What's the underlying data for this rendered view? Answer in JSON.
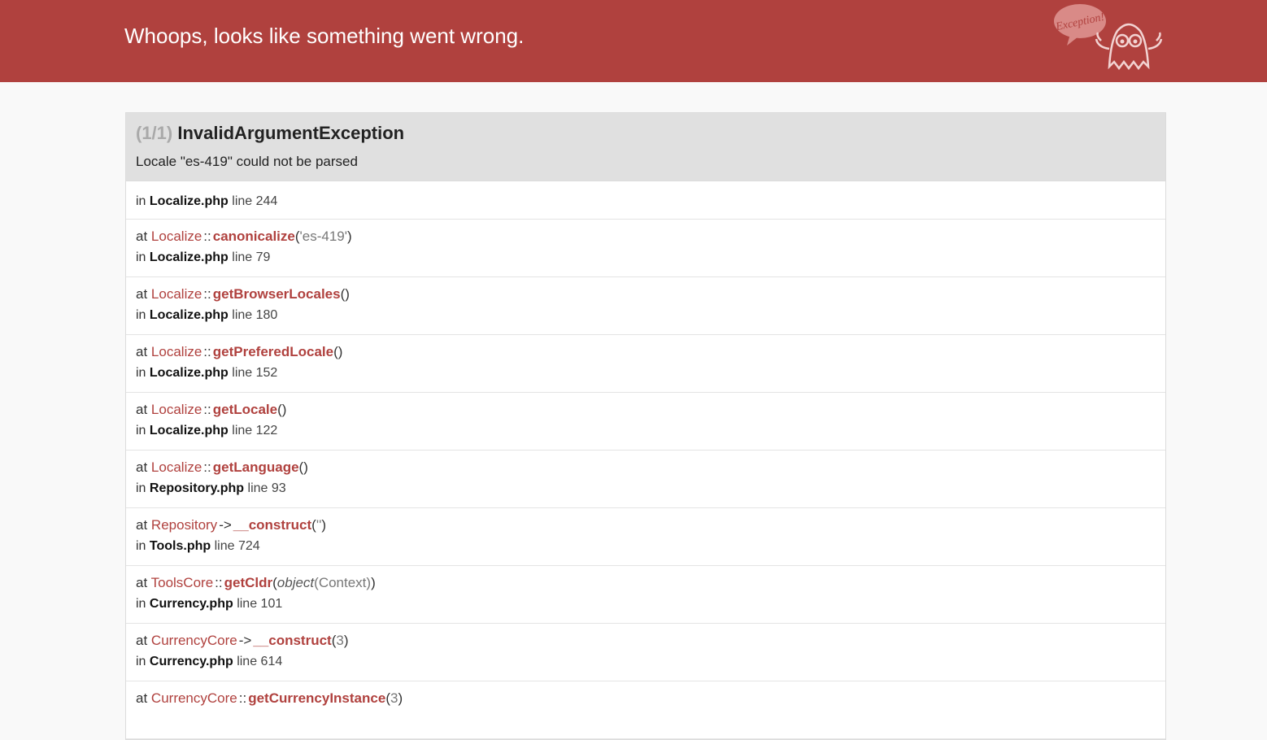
{
  "header": {
    "title": "Whoops, looks like something went wrong.",
    "logo_text": "Exception!",
    "logo_icon": "ghost-icon",
    "background": "#b0413e"
  },
  "exception": {
    "count": "(1/1)",
    "class": "InvalidArgumentException",
    "message": "Locale \"es-419\" could not be parsed"
  },
  "origin": {
    "in_label": "in",
    "file": "Localize.php",
    "line_label": "line",
    "line": "244"
  },
  "frames": [
    {
      "at": "at",
      "class": "Localize",
      "sep": "::",
      "method": "canonicalize",
      "open": "(",
      "args": "'es-419'",
      "close": ")",
      "in": "in",
      "file": "Localize.php",
      "line_label": "line",
      "line": "79"
    },
    {
      "at": "at",
      "class": "Localize",
      "sep": "::",
      "method": "getBrowserLocales",
      "open": "(",
      "args": "",
      "close": ")",
      "in": "in",
      "file": "Localize.php",
      "line_label": "line",
      "line": "180"
    },
    {
      "at": "at",
      "class": "Localize",
      "sep": "::",
      "method": "getPreferedLocale",
      "open": "(",
      "args": "",
      "close": ")",
      "in": "in",
      "file": "Localize.php",
      "line_label": "line",
      "line": "152"
    },
    {
      "at": "at",
      "class": "Localize",
      "sep": "::",
      "method": "getLocale",
      "open": "(",
      "args": "",
      "close": ")",
      "in": "in",
      "file": "Localize.php",
      "line_label": "line",
      "line": "122"
    },
    {
      "at": "at",
      "class": "Localize",
      "sep": "::",
      "method": "getLanguage",
      "open": "(",
      "args": "",
      "close": ")",
      "in": "in",
      "file": "Repository.php",
      "line_label": "line",
      "line": "93"
    },
    {
      "at": "at",
      "class": "Repository",
      "sep": "->",
      "method": "__construct",
      "open": "(",
      "args": "''",
      "close": ")",
      "in": "in",
      "file": "Tools.php",
      "line_label": "line",
      "line": "724"
    },
    {
      "at": "at",
      "class": "ToolsCore",
      "sep": "::",
      "method": "getCldr",
      "open": "(",
      "args_type": "object",
      "args": "(Context)",
      "close": ")",
      "in": "in",
      "file": "Currency.php",
      "line_label": "line",
      "line": "101"
    },
    {
      "at": "at",
      "class": "CurrencyCore",
      "sep": "->",
      "method": "__construct",
      "open": "(",
      "args": "3",
      "close": ")",
      "in": "in",
      "file": "Currency.php",
      "line_label": "line",
      "line": "614"
    },
    {
      "at": "at",
      "class": "CurrencyCore",
      "sep": "::",
      "method": "getCurrencyInstance",
      "open": "(",
      "args": "3",
      "close": ")"
    }
  ]
}
